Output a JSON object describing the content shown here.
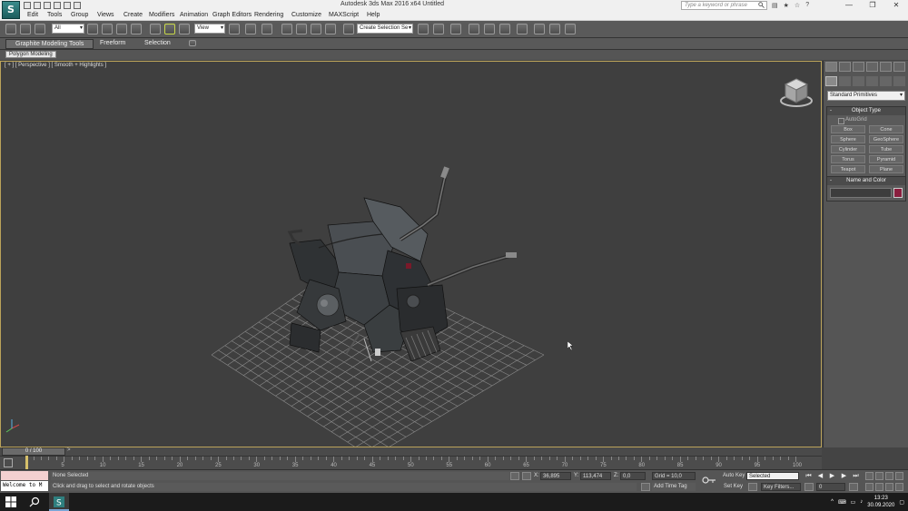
{
  "titlebar": {
    "app_title": "Autodesk 3ds Max  2016 x64       Untitled",
    "search_placeholder": "Type a keyword or phrase",
    "min": "—",
    "max": "❐",
    "close": "✕"
  },
  "menu": [
    "Edit",
    "Tools",
    "Group",
    "Views",
    "Create",
    "Modifiers",
    "Animation",
    "Graph Editors",
    "Rendering",
    "Customize",
    "MAXScript",
    "Help"
  ],
  "toolbar": {
    "selection_filter": "All",
    "ref_coord": "View",
    "named_selection": "Create Selection Se"
  },
  "ribbon": {
    "tabs": [
      "Graphite Modeling Tools",
      "Freeform",
      "Selection"
    ],
    "sub_tab": "Polygon Modeling"
  },
  "viewport": {
    "label": "[ + ] [ Perspective ] [ Smooth + Highlights ]"
  },
  "command_panel": {
    "category": "Standard Primitives",
    "object_type_title": "Object Type",
    "autogrid": "AutoGrid",
    "objects": [
      "Box",
      "Cone",
      "Sphere",
      "GeoSphere",
      "Cylinder",
      "Tube",
      "Torus",
      "Pyramid",
      "Teapot",
      "Plane"
    ],
    "name_color_title": "Name and Color",
    "object_color": "#8a1f3e"
  },
  "timeline": {
    "frame_display": "0 / 100",
    "left_arrow": "<",
    "right_arrow": ">",
    "ticks": [
      "5",
      "10",
      "15",
      "20",
      "25",
      "30",
      "35",
      "40",
      "45",
      "50",
      "55",
      "60",
      "65",
      "70",
      "75",
      "80",
      "85",
      "90",
      "95",
      "100"
    ]
  },
  "status": {
    "maxscript_text": "Welcome to M",
    "selection": "None Selected",
    "prompt": "Click and drag to select and rotate objects",
    "x_label": "X:",
    "x_value": "36,895",
    "y_label": "Y:",
    "y_value": "113,474",
    "z_label": "Z:",
    "z_value": "0,0",
    "grid": "Grid = 10,0",
    "add_time_tag": "Add Time Tag",
    "auto_key": "Auto Key",
    "auto_key_mode": "Selected",
    "set_key": "Set Key",
    "key_filters": "Key Filters...",
    "current_frame": "0"
  },
  "taskbar": {
    "time": "13:23",
    "date": "30.09.2020"
  }
}
